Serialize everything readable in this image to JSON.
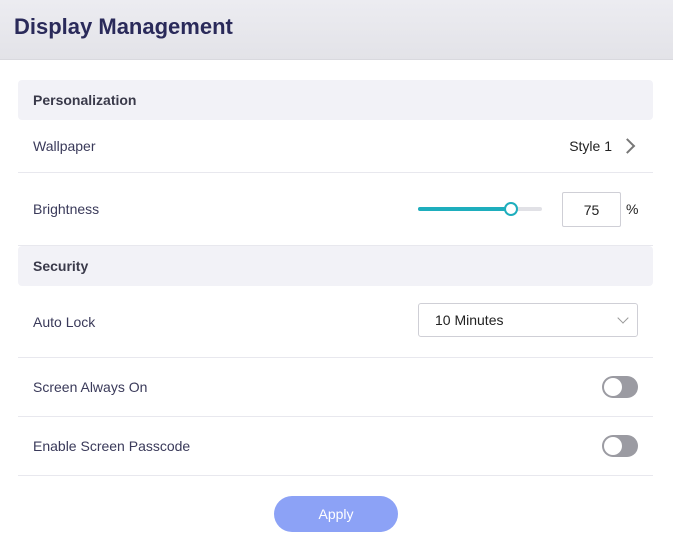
{
  "page": {
    "title": "Display Management"
  },
  "personalization": {
    "title": "Personalization",
    "wallpaper": {
      "label": "Wallpaper",
      "value": "Style 1",
      "icon": "chevron-right-icon"
    },
    "brightness": {
      "label": "Brightness",
      "value": "75",
      "slider_level": 0.75,
      "unit": "%",
      "accent_color": "#1eaebd"
    }
  },
  "security": {
    "title": "Security",
    "auto_lock": {
      "label": "Auto Lock",
      "selected": "10 Minutes",
      "icon": "chevron-down-icon"
    },
    "screen_always_on": {
      "label": "Screen Always On",
      "enabled": false
    },
    "screen_passcode": {
      "label": "Enable Screen Passcode",
      "enabled": false
    }
  },
  "footer": {
    "apply_label": "Apply",
    "apply_color": "#8ca2f6"
  }
}
